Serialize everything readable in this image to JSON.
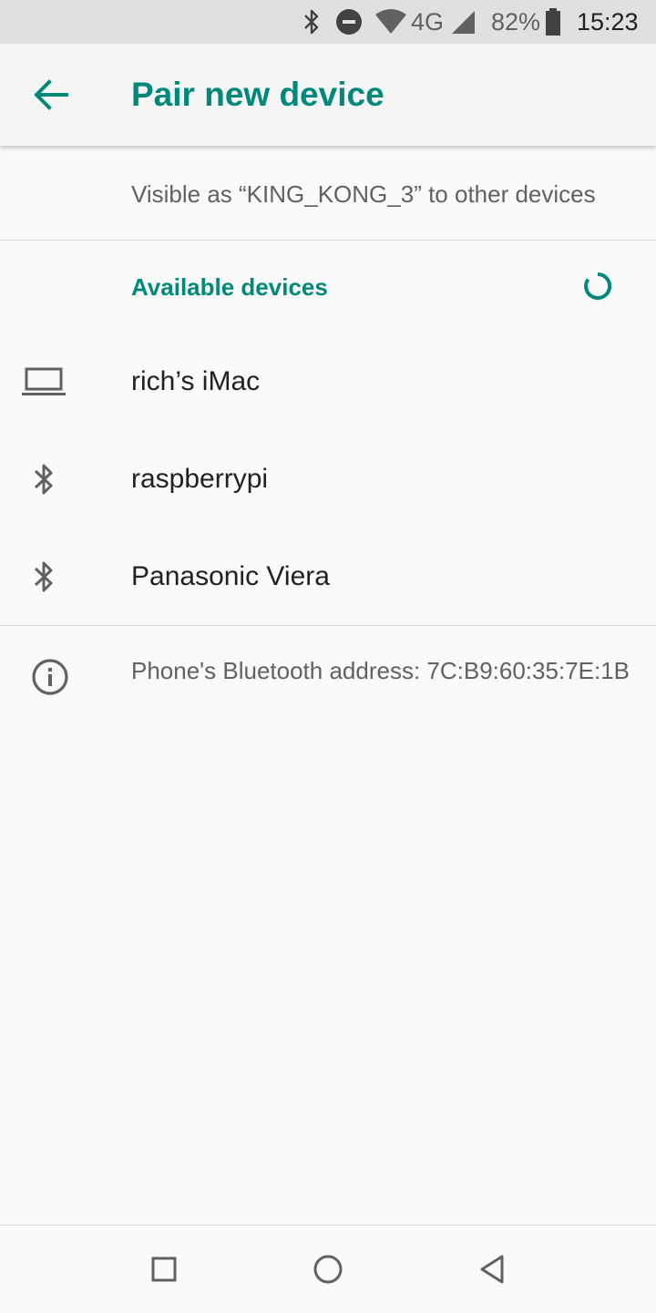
{
  "status_bar": {
    "network": "4G",
    "battery": "82%",
    "time": "15:23",
    "icons": [
      "bluetooth-icon",
      "do-not-disturb-icon",
      "wifi-icon",
      "cell-signal-icon",
      "battery-icon"
    ]
  },
  "app_bar": {
    "title": "Pair new device",
    "back_icon": "arrow-left-icon"
  },
  "visible_as": "Visible as “KING_KONG_3” to other devices",
  "available_devices": {
    "title": "Available devices",
    "devices": [
      {
        "name": "rich’s iMac",
        "icon": "laptop-icon"
      },
      {
        "name": "raspberrypi",
        "icon": "bluetooth-icon"
      },
      {
        "name": "Panasonic Viera",
        "icon": "bluetooth-icon"
      }
    ]
  },
  "bluetooth_address": "Phone's Bluetooth address: 7C:B9:60:35:7E:1B",
  "nav_bar": {
    "buttons": [
      "recents-square-icon",
      "home-circle-icon",
      "back-triangle-icon"
    ]
  },
  "colors": {
    "accent": "#00897b",
    "status_bar_bg": "#e0e0e0",
    "app_bar_bg": "#f5f5f5",
    "page_bg": "#fafafa"
  }
}
